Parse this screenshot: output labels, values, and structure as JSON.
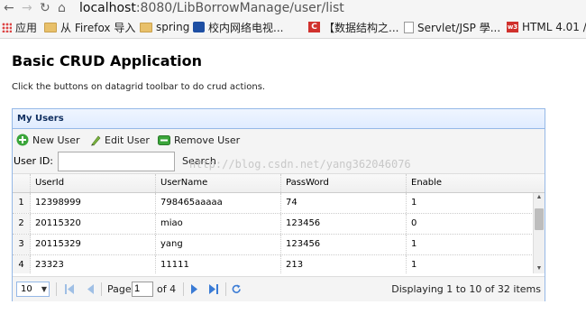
{
  "browser": {
    "url_host": "localhost",
    "url_rest": ":8080/LibBorrowManage/user/list",
    "bookmarks": [
      {
        "label": "应用",
        "icon": "apps-grid-icon"
      },
      {
        "label": "从 Firefox 导入",
        "icon": "folder-icon"
      },
      {
        "label": "spring",
        "icon": "folder-icon"
      },
      {
        "label": "校内网络电视...",
        "icon": "tv-site-icon"
      },
      {
        "label": "【数据结构之...",
        "icon": "csdn-icon"
      },
      {
        "label": "Servlet/JSP 學...",
        "icon": "page-icon"
      },
      {
        "label": "HTML 4.01 /",
        "icon": "w3school-icon"
      }
    ]
  },
  "page": {
    "title": "Basic CRUD Application",
    "description": "Click the buttons on datagrid toolbar to do crud actions."
  },
  "panel": {
    "title": "My Users",
    "toolbar": {
      "new_label": "New User",
      "edit_label": "Edit User",
      "remove_label": "Remove User"
    },
    "search": {
      "label": "User ID:",
      "value": "",
      "button_label": "Search"
    },
    "watermark": "http://blog.csdn.net/yang362046076",
    "grid": {
      "columns": [
        "UserId",
        "UserName",
        "PassWord",
        "Enable"
      ],
      "rows": [
        {
          "num": "1",
          "cells": [
            "12398999",
            "798465aaaaa",
            "74",
            "1"
          ]
        },
        {
          "num": "2",
          "cells": [
            "20115320",
            "miao",
            "123456",
            "0"
          ]
        },
        {
          "num": "3",
          "cells": [
            "20115329",
            "yang",
            "123456",
            "1"
          ]
        },
        {
          "num": "4",
          "cells": [
            "23323",
            "11111",
            "213",
            "1"
          ]
        }
      ]
    },
    "pager": {
      "page_size": "10",
      "page_label": "Page",
      "page_value": "1",
      "of_label": "of 4",
      "info": "Displaying 1 to 10 of 32 items"
    }
  },
  "colors": {
    "panel_border": "#95b8e7",
    "panel_title_text": "#0e2d5f",
    "pager_icon_blue": "#3a7bd5"
  }
}
